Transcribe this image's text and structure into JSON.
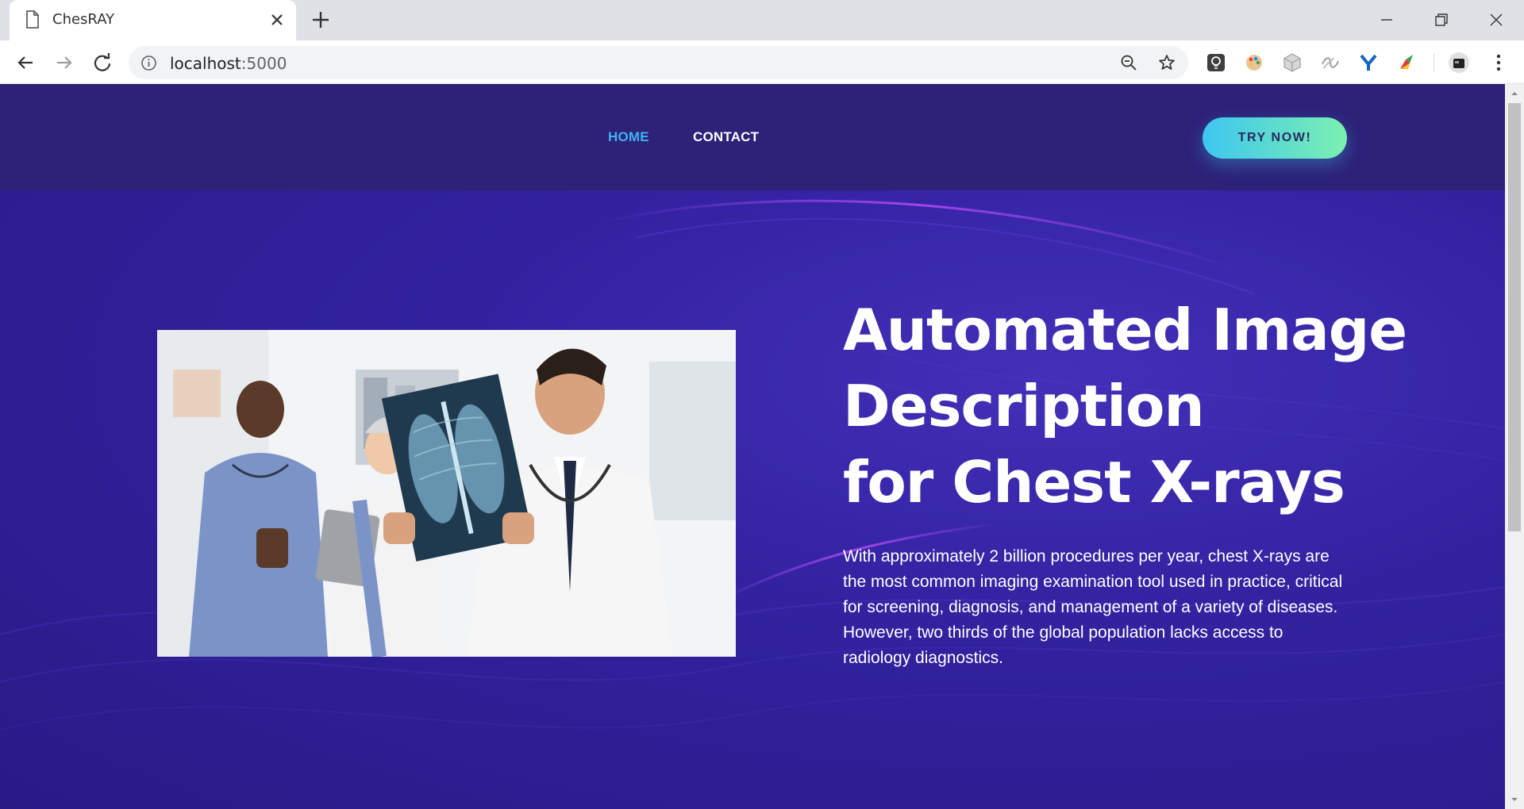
{
  "browser": {
    "tab_title": "ChesRAY",
    "url_host": "localhost",
    "url_port": ":5000"
  },
  "nav": {
    "home_label": "HOME",
    "contact_label": "CONTACT",
    "cta_label": "TRY NOW!"
  },
  "hero": {
    "title_line_1": "Automated Image",
    "title_line_2": "Description",
    "title_line_3": "for Chest X-rays",
    "description": "With approximately 2 billion procedures per year, chest X-rays are the most common imaging examination tool used in practice, critical for screening, diagnosis, and management of a variety of diseases. However, two thirds of the global population lacks access to radiology diagnostics."
  },
  "colors": {
    "nav_active": "#3db4f2",
    "header_bg": "#2d2178",
    "page_bg": "#3222a0",
    "cta_gradient_start": "#3ec6f0",
    "cta_gradient_end": "#7bf0b0"
  }
}
